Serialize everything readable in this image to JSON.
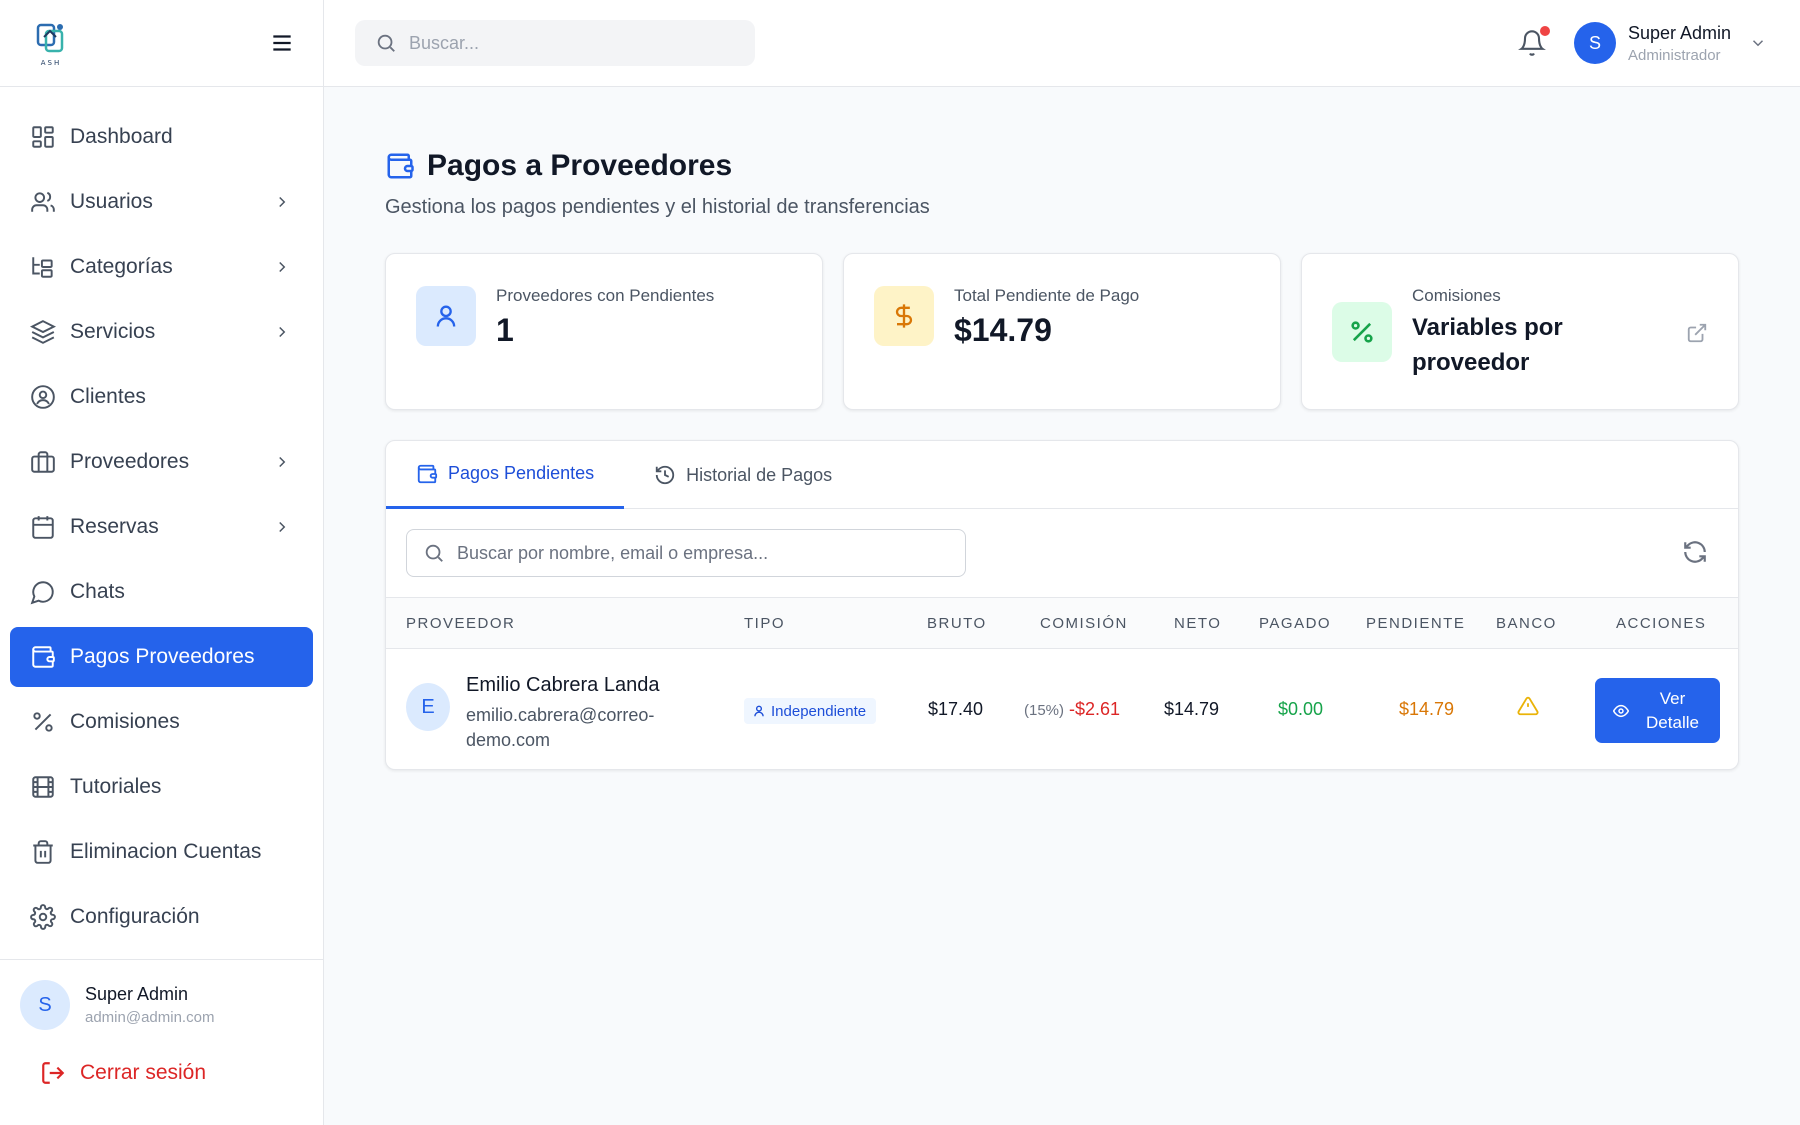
{
  "sidebar": {
    "logo_text": "ASH",
    "items": [
      {
        "label": "Dashboard"
      },
      {
        "label": "Usuarios"
      },
      {
        "label": "Categorías"
      },
      {
        "label": "Servicios"
      },
      {
        "label": "Clientes"
      },
      {
        "label": "Proveedores"
      },
      {
        "label": "Reservas"
      },
      {
        "label": "Chats"
      },
      {
        "label": "Pagos Proveedores"
      },
      {
        "label": "Comisiones"
      },
      {
        "label": "Tutoriales"
      },
      {
        "label": "Eliminacion Cuentas"
      },
      {
        "label": "Configuración"
      }
    ],
    "user": {
      "initial": "S",
      "name": "Super Admin",
      "email": "admin@admin.com"
    },
    "logout_label": "Cerrar sesión"
  },
  "header": {
    "search_placeholder": "Buscar...",
    "user": {
      "initial": "S",
      "name": "Super Admin",
      "role": "Administrador"
    }
  },
  "page": {
    "title": "Pagos a Proveedores",
    "subtitle": "Gestiona los pagos pendientes y el historial de transferencias"
  },
  "cards": [
    {
      "label": "Proveedores con Pendientes",
      "value": "1"
    },
    {
      "label": "Total Pendiente de Pago",
      "value": "$14.79"
    },
    {
      "label": "Comisiones",
      "value": "Variables por proveedor"
    }
  ],
  "tabs": [
    {
      "label": "Pagos Pendientes"
    },
    {
      "label": "Historial de Pagos"
    }
  ],
  "table": {
    "search_placeholder": "Buscar por nombre, email o empresa...",
    "columns": [
      "PROVEEDOR",
      "TIPO",
      "BRUTO",
      "COMISIÓN",
      "NETO",
      "PAGADO",
      "PENDIENTE",
      "BANCO",
      "ACCIONES"
    ],
    "rows": [
      {
        "initial": "E",
        "name": "Emilio Cabrera Landa",
        "email": "emilio.cabrera@correo-demo.com",
        "tipo": "Independiente",
        "bruto": "$17.40",
        "comision_pct": "(15%)",
        "comision": "-$2.61",
        "neto": "$14.79",
        "pagado": "$0.00",
        "pendiente": "$14.79",
        "action_label": "Ver Detalle"
      }
    ]
  },
  "colors": {
    "accent": "#2563eb",
    "danger": "#dc2626",
    "success": "#16a34a",
    "warning": "#d97706"
  }
}
